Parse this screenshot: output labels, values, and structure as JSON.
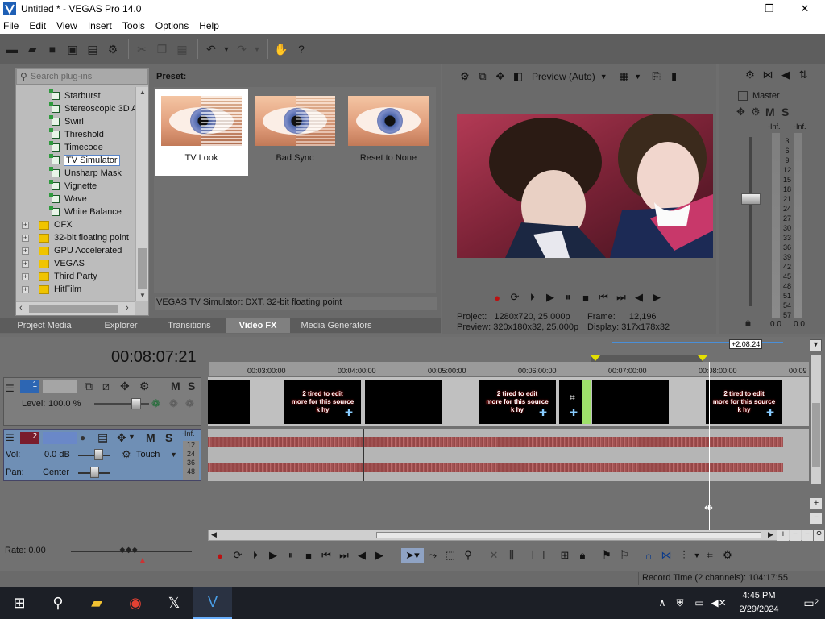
{
  "window": {
    "title": "Untitled * - VEGAS Pro 14.0",
    "minimize": "—",
    "maximize": "❐",
    "close": "✕"
  },
  "menu": [
    "File",
    "Edit",
    "View",
    "Insert",
    "Tools",
    "Options",
    "Help"
  ],
  "explorer": {
    "search_placeholder": "Search plug-ins",
    "preset_label": "Preset:",
    "plugins": [
      "Starburst",
      "Stereoscopic 3D A",
      "Swirl",
      "Threshold",
      "Timecode",
      "TV Simulator",
      "Unsharp Mask",
      "Vignette",
      "Wave",
      "White Balance"
    ],
    "selected_plugin": "TV Simulator",
    "folders": [
      "OFX",
      "32-bit floating point",
      "GPU Accelerated",
      "VEGAS",
      "Third Party",
      "HitFilm"
    ],
    "expander": "+",
    "presets": [
      {
        "label": "TV Look",
        "active": true
      },
      {
        "label": "Bad Sync",
        "active": false
      },
      {
        "label": "Reset to None",
        "active": false
      }
    ],
    "status": "VEGAS TV Simulator: DXT, 32-bit floating point",
    "tabs": [
      "Project Media",
      "Explorer",
      "Transitions",
      "Video FX",
      "Media Generators"
    ],
    "active_tab": "Video FX"
  },
  "preview": {
    "mode": "Preview (Auto)",
    "project_label": "Project:",
    "project_value": "1280x720, 25.000p",
    "preview_label": "Preview:",
    "preview_value": "320x180x32, 25.000p",
    "frame_label": "Frame:",
    "frame_value": "12,196",
    "display_label": "Display:",
    "display_value": "317x178x32"
  },
  "master": {
    "title": "Master",
    "m": "M",
    "s": "S",
    "inf_left": "-Inf.",
    "inf_right": "-Inf.",
    "scale": [
      "3",
      "6",
      "9",
      "12",
      "15",
      "18",
      "21",
      "24",
      "27",
      "30",
      "33",
      "36",
      "39",
      "42",
      "45",
      "48",
      "51",
      "54",
      "57"
    ],
    "level_left": "0.0",
    "level_right": "0.0"
  },
  "timeline": {
    "timecode": "00:08:07:21",
    "marker_offset": "+2:08:24",
    "ruler": [
      "00:03:00:00",
      "00:04:00:00",
      "00:05:00:00",
      "00:06:00:00",
      "00:07:00:00",
      "00:08:00:00",
      "00:09"
    ],
    "clip_text": "2 tired to edit\nmore for this source\nk hy",
    "video_track": {
      "number": "1",
      "m": "M",
      "s": "S",
      "level_label": "Level:",
      "level_value": "100.0 %"
    },
    "audio_track": {
      "number": "2",
      "m": "M",
      "s": "S",
      "inf": "-Inf.",
      "vol_label": "Vol:",
      "vol_value": "0.0 dB",
      "pan_label": "Pan:",
      "pan_value": "Center",
      "mode": "Touch",
      "meter_scale": [
        "12",
        "24",
        "36",
        "48"
      ]
    },
    "rate_label": "Rate: 0.00",
    "record_time": "Record Time (2 channels): 104:17:55"
  },
  "taskbar": {
    "time": "4:45 PM",
    "date": "2/29/2024",
    "notifications": "2"
  },
  "colors": {
    "panel": "#6a6a6a",
    "audio_header": "#6f8fb5",
    "accent_blue": "#2d66b3"
  }
}
